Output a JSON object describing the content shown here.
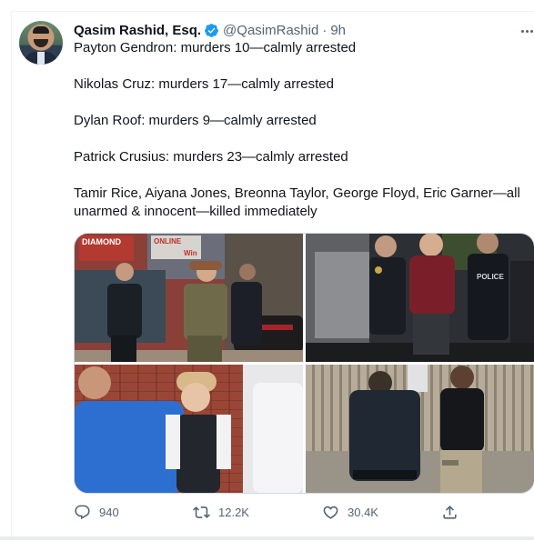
{
  "author": {
    "name": "Qasim Rashid, Esq.",
    "handle": "@QasimRashid",
    "separator": "·",
    "time": "9h",
    "verified": true
  },
  "tweet": {
    "paragraphs": [
      "Payton Gendron: murders 10—calmly arrested",
      "Nikolas Cruz: murders 17—calmly arrested",
      "Dylan Roof: murders 9—calmly arrested",
      "Patrick Crusius: murders 23—calmly arrested",
      "Tamir Rice, Aiyana Jones, Breonna Taylor, George Floyd, Eric Garner—all unarmed & innocent—killed immediately"
    ]
  },
  "media": {
    "photo1_signs": [
      "DIAMOND",
      "ONLINE",
      "Win"
    ],
    "photo2_sign": "POLICE"
  },
  "stats": {
    "replies": "940",
    "retweets": "12.2K",
    "likes": "30.4K"
  },
  "icons": {
    "verified": "verified-badge-icon",
    "more": "more-icon",
    "reply": "reply-icon",
    "retweet": "retweet-icon",
    "like": "heart-icon",
    "share": "share-icon"
  },
  "colors": {
    "text": "#0f1419",
    "secondary": "#536471",
    "verified": "#1d9bf0",
    "border": "#cfd9de"
  }
}
